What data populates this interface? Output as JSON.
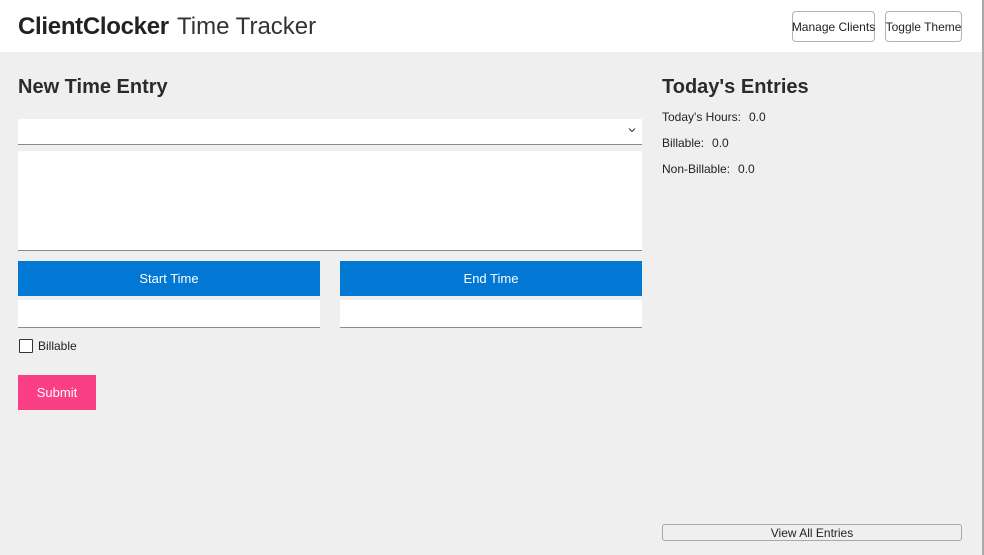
{
  "header": {
    "app_name": "ClientClocker",
    "app_subtitle": "Time Tracker",
    "manage_clients_label": "Manage Clients",
    "toggle_theme_label": "Toggle Theme"
  },
  "entry_form": {
    "title": "New Time Entry",
    "client_select_value": "",
    "notes_value": "",
    "start_time_label": "Start Time",
    "end_time_label": "End Time",
    "start_time_value": "",
    "end_time_value": "",
    "billable_label": "Billable",
    "billable_checked": false,
    "submit_label": "Submit"
  },
  "today": {
    "title": "Today's Entries",
    "hours_label": "Today's Hours:",
    "hours_value": "0.0",
    "billable_label": "Billable:",
    "billable_value": "0.0",
    "nonbillable_label": "Non-Billable:",
    "nonbillable_value": "0.0",
    "view_all_label": "View All Entries"
  },
  "colors": {
    "accent_blue": "#0078d4",
    "submit_pink": "#fb3f85",
    "background": "#efefef",
    "header_bg": "#ffffff"
  },
  "icons": {
    "client_dropdown": "chevron-down-icon"
  }
}
